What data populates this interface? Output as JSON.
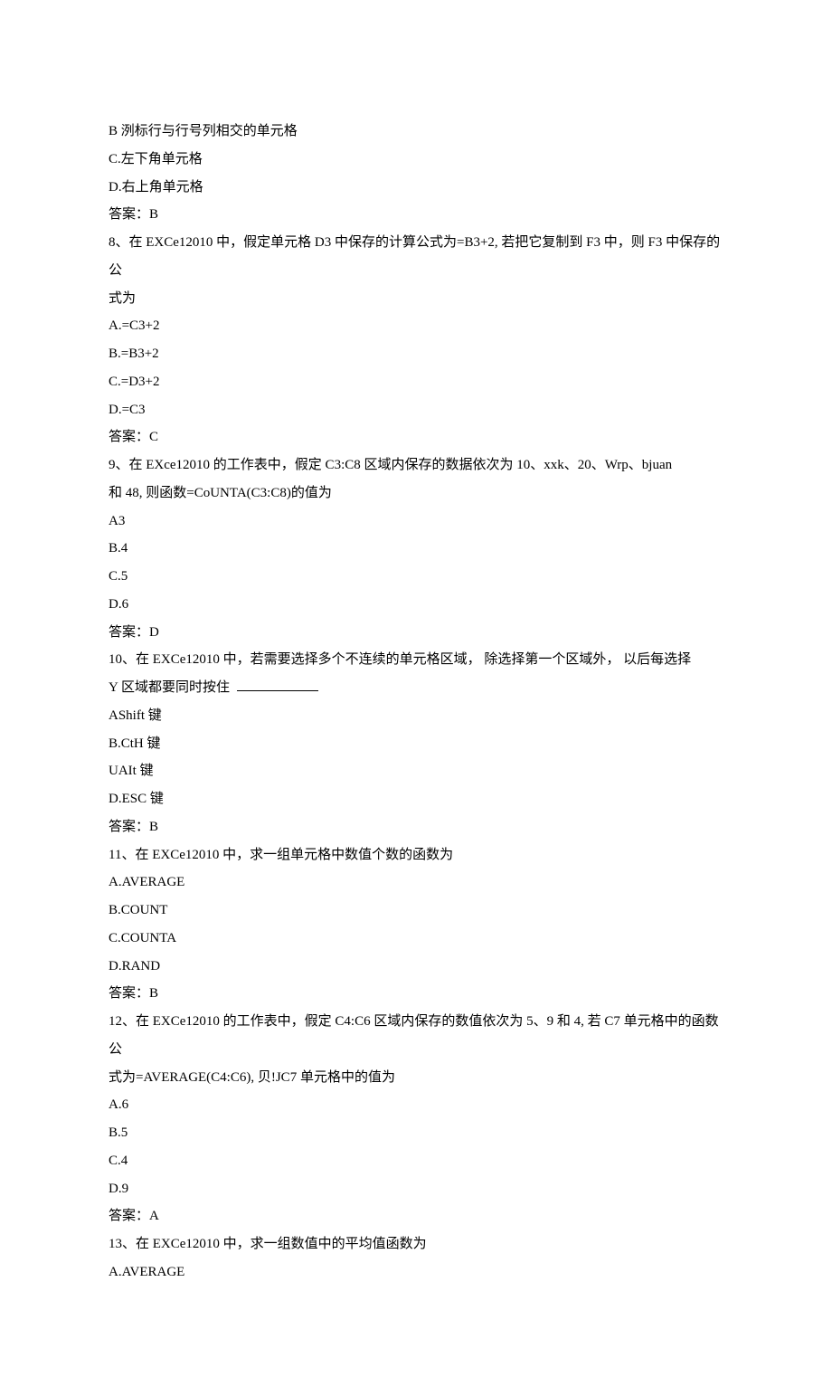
{
  "q7": {
    "optB": "B 洌标行与行号列相交的单元格",
    "optC": "C.左下角单元格",
    "optD": "D.右上角单元格",
    "answer": "答案：B"
  },
  "q8": {
    "stem1": "8、在 EXCe12010 中，假定单元格 D3 中保存的计算公式为=B3+2, 若把它复制到 F3 中，则 F3 中保存的公",
    "stem2": "式为",
    "optA": "A.=C3+2",
    "optB": "B.=B3+2",
    "optC": "C.=D3+2",
    "optD": "D.=C3",
    "answer": "答案：C"
  },
  "q9": {
    "stem1": "9、在 EXce12010 的工作表中，假定 C3:C8 区域内保存的数据依次为 10、xxk、20、Wrp、bjuan",
    "stem2": "和 48, 则函数=CoUNTA(C3:C8)的值为",
    "optA": "A3",
    "optB": "B.4",
    "optC": "C.5",
    "optD": "D.6",
    "answer": "答案：D"
  },
  "q10": {
    "stem1": "10、在 EXCe12010 中，若需要选择多个不连续的单元格区域， 除选择第一个区域外， 以后每选择",
    "stem2": "Y 区域都要同时按住 ",
    "optA": "AShift 键",
    "optB": "B.CtH 键",
    "optC": "UAIt 键",
    "optD": "D.ESC 键",
    "answer": "答案：B"
  },
  "q11": {
    "stem": "11、在 EXCe12010 中，求一组单元格中数值个数的函数为",
    "optA": "A.AVERAGE",
    "optB": "B.COUNT",
    "optC": "C.COUNTA",
    "optD": "D.RAND",
    "answer": "答案：B"
  },
  "q12": {
    "stem1": "12、在 EXCe12010 的工作表中，假定 C4:C6 区域内保存的数值依次为 5、9 和 4, 若 C7 单元格中的函数公",
    "stem2": "式为=AVERAGE(C4:C6), 贝!JC7 单元格中的值为",
    "optA": "A.6",
    "optB": "B.5",
    "optC": "C.4",
    "optD": "D.9",
    "answer": "答案：A"
  },
  "q13": {
    "stem": "13、在 EXCe12010 中，求一组数值中的平均值函数为",
    "optA": "A.AVERAGE"
  }
}
